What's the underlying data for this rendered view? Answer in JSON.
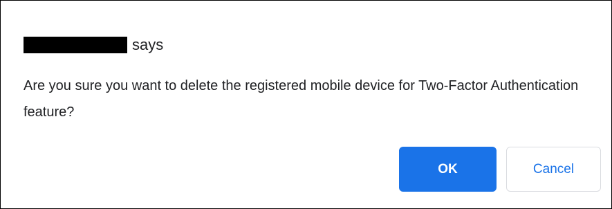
{
  "dialog": {
    "origin_redacted": "",
    "says_label": "says",
    "message": "Are you sure you want to delete the registered mobile device for Two-Factor Authentication feature?",
    "ok_label": "OK",
    "cancel_label": "Cancel"
  },
  "colors": {
    "primary": "#1a73e8",
    "text": "#202124",
    "border": "#000000",
    "cancel_border": "#dadce0"
  }
}
